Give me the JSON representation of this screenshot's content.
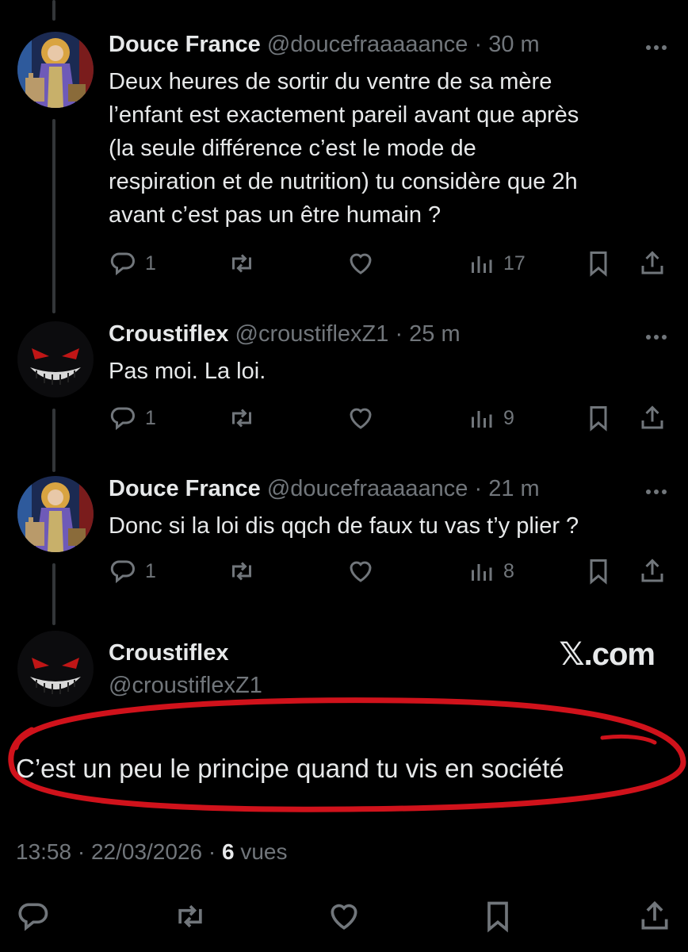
{
  "tweets": [
    {
      "name": "Douce France",
      "handle": "@doucefraaaaance",
      "time": "· 30 m",
      "text_lines": [
        "Deux heures de sortir du ventre de sa mère",
        "l’enfant est exactement pareil avant que après",
        "(la seule différence c’est le mode de",
        "respiration et de nutrition) tu considère que 2h",
        "avant c’est pas un être humain ?"
      ],
      "replies": "1",
      "views": "17",
      "avatar": "saint-stained-glass-avatar"
    },
    {
      "name": "Croustiflex",
      "handle": "@croustiflexZ1",
      "time": "· 25 m",
      "text_lines": [
        "Pas moi. La loi."
      ],
      "replies": "1",
      "views": "9",
      "avatar": "gengar-grin-avatar"
    },
    {
      "name": "Douce France",
      "handle": "@doucefraaaaance",
      "time": "· 21 m",
      "text_lines": [
        "Donc si la loi dis qqch de faux tu vas t’y plier ?"
      ],
      "replies": "1",
      "views": "8",
      "avatar": "saint-stained-glass-avatar"
    }
  ],
  "main_tweet": {
    "name": "Croustiflex",
    "handle": "@croustiflexZ1",
    "brand": "𝕏.com",
    "text": "C’est un peu le principe quand tu vis en société",
    "time": "13:58 · 22/03/2026 · ",
    "views_count": "6",
    "views_label": " vues"
  },
  "colors": {
    "background": "#000000",
    "text": "#e7e9ea",
    "muted": "#71767b",
    "highlight_circle": "#d0121b"
  },
  "icons": [
    "reply-icon",
    "retweet-icon",
    "like-icon",
    "views-icon",
    "bookmark-icon",
    "share-icon",
    "more-icon"
  ]
}
